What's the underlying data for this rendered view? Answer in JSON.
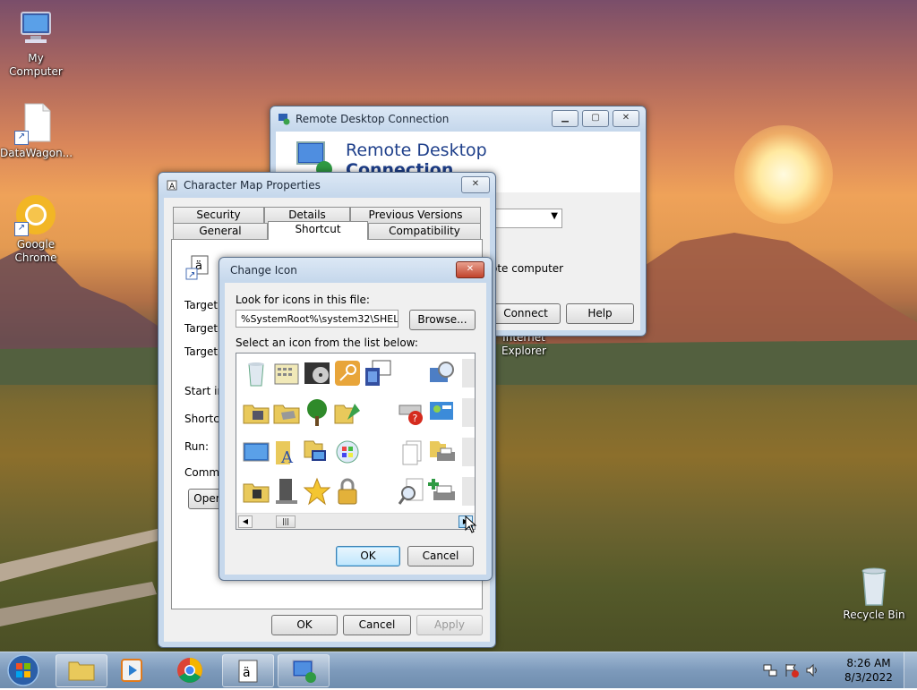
{
  "desktop": {
    "icons": [
      {
        "label": "My Computer"
      },
      {
        "label": "DataWagon..."
      },
      {
        "label": "Google Chrome"
      },
      {
        "label": "Recycle Bin"
      }
    ]
  },
  "rdc": {
    "title": "Remote Desktop Connection",
    "header_line1": "Remote Desktop",
    "header_line2": "Connection",
    "remote_text": "ote computer",
    "connect_label": "Connect",
    "help_label": "Help",
    "ie_label_1": "Internet",
    "ie_label_2": "Explorer"
  },
  "charmap": {
    "title": "Character Map Properties",
    "tabs_row1": [
      "Security",
      "Details",
      "Previous Versions"
    ],
    "tabs_row2": [
      "General",
      "Shortcut",
      "Compatibility"
    ],
    "active_tab": "Shortcut",
    "labels": [
      "Target ty",
      "Target lo",
      "Target:",
      "Start in:",
      "Shortcut",
      "Run:",
      "Commen"
    ],
    "open_label": "Oper",
    "ok_label": "OK",
    "cancel_label": "Cancel",
    "apply_label": "Apply"
  },
  "change_icon": {
    "title": "Change Icon",
    "look_label": "Look for icons in this file:",
    "file_path": "%SystemRoot%\\system32\\SHELL32",
    "browse_label": "Browse...",
    "select_label": "Select an icon from the list below:",
    "ok_label": "OK",
    "cancel_label": "Cancel"
  },
  "taskbar": {
    "time": "8:26 AM",
    "date": "8/3/2022"
  },
  "colors": {
    "accent": "#3c7fb1",
    "taskbar": "#7d9abb",
    "title_text": "#1e3f8a"
  }
}
